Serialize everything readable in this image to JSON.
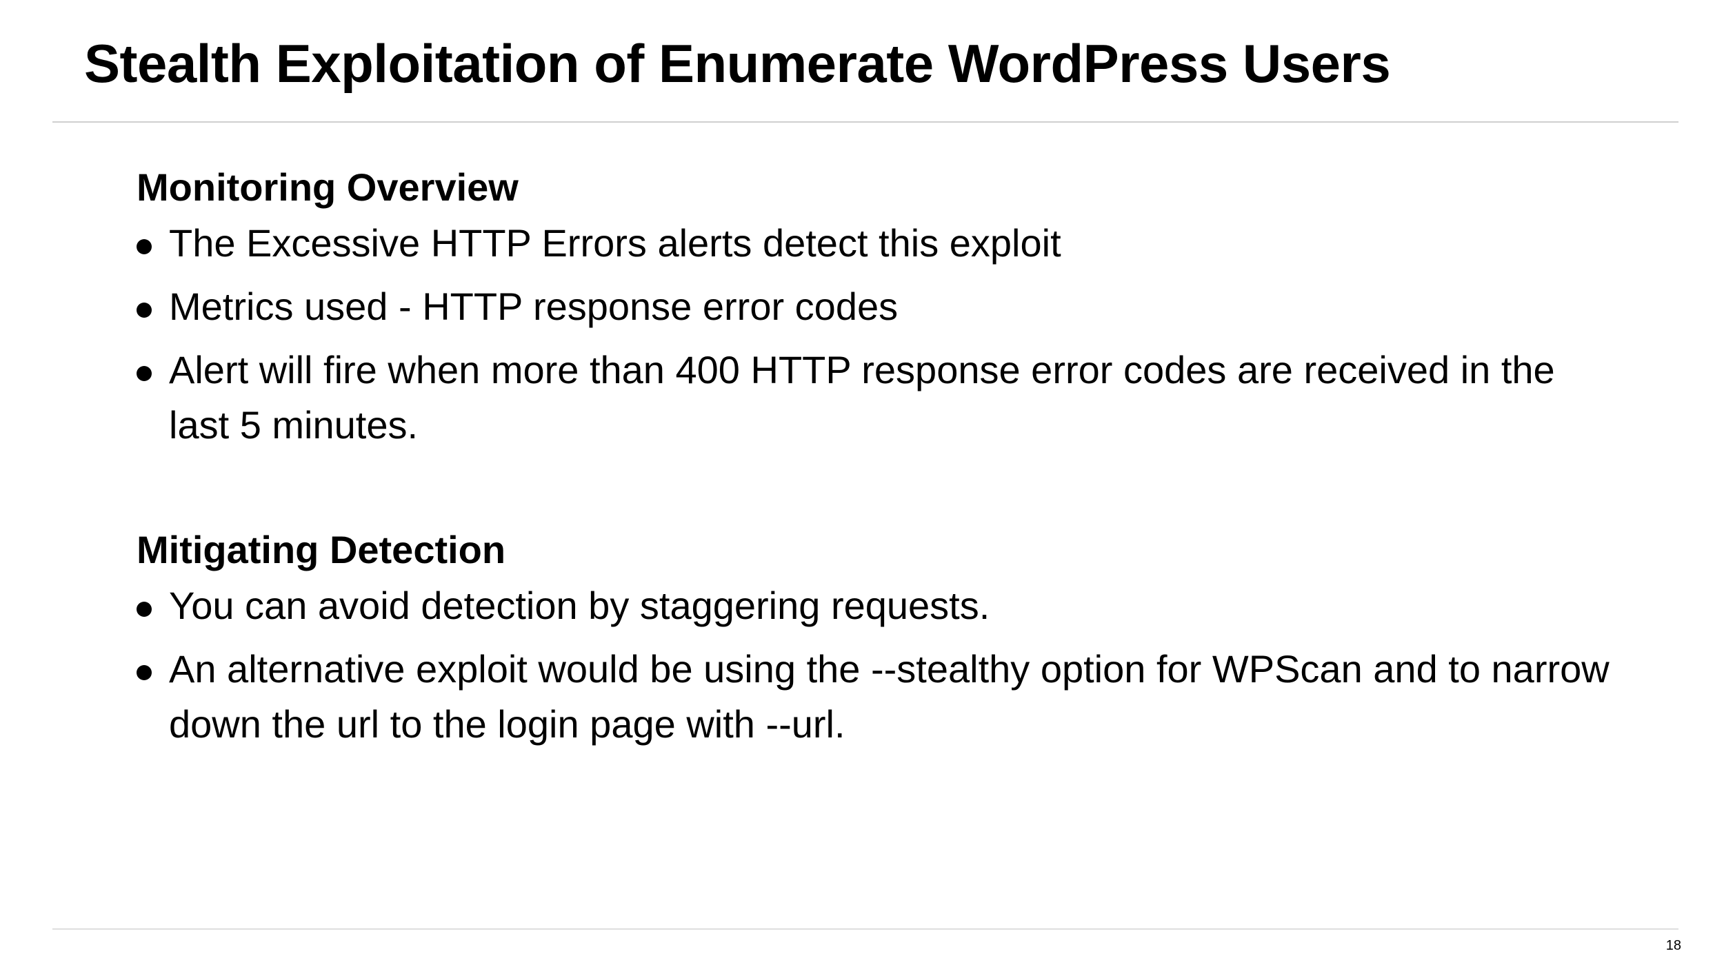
{
  "slide": {
    "title": "Stealth Exploitation of Enumerate WordPress Users",
    "page_number": "18"
  },
  "sections": [
    {
      "heading": "Monitoring Overview",
      "bullets": [
        "The Excessive HTTP Errors alerts detect this exploit",
        "Metrics used - HTTP response error codes",
        "Alert will fire when more than 400 HTTP response error codes are received in the last 5 minutes."
      ]
    },
    {
      "heading": "Mitigating Detection",
      "bullets": [
        "You can avoid detection by staggering requests.",
        "An alternative exploit would be using the --stealthy option for WPScan and to narrow down the url to the login page with --url."
      ]
    }
  ]
}
